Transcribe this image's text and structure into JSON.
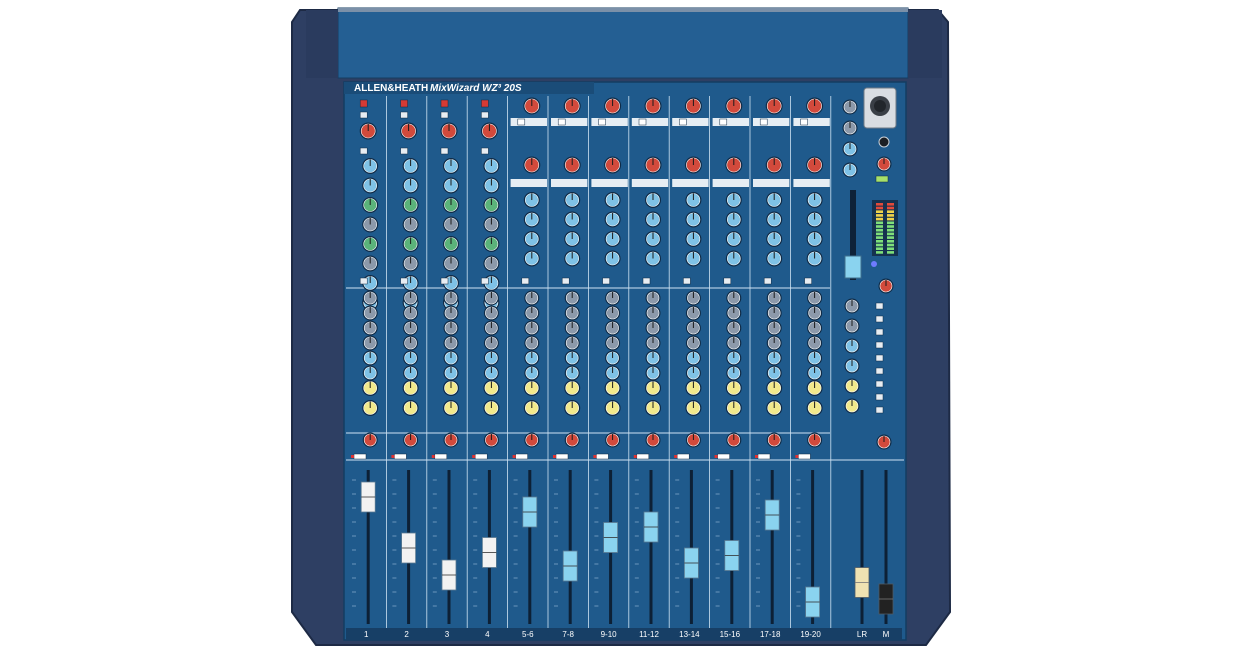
{
  "panel": {
    "brand": "ALLEN&HEATH",
    "model": "MixWizard WZ³ 20S"
  },
  "strips": [
    {
      "label": "1",
      "type": "mono",
      "fader_level": 0.82
    },
    {
      "label": "2",
      "type": "mono",
      "fader_level": 0.48
    },
    {
      "label": "3",
      "type": "mono",
      "fader_level": 0.3
    },
    {
      "label": "4",
      "type": "mono",
      "fader_level": 0.45
    },
    {
      "label": "5-6",
      "type": "stereo",
      "fader_level": 0.72
    },
    {
      "label": "7-8",
      "type": "stereo",
      "fader_level": 0.36
    },
    {
      "label": "9-10",
      "type": "stereo",
      "fader_level": 0.55
    },
    {
      "label": "11-12",
      "type": "stereo",
      "fader_level": 0.62
    },
    {
      "label": "13-14",
      "type": "stereo",
      "fader_level": 0.38
    },
    {
      "label": "15-16",
      "type": "stereo",
      "fader_level": 0.43
    },
    {
      "label": "17-18",
      "type": "stereo",
      "fader_level": 0.7
    },
    {
      "label": "19-20",
      "type": "stereo",
      "fader_level": 0.12
    }
  ],
  "masters": [
    {
      "label": "LR",
      "fader_level": 0.25
    },
    {
      "label": "M",
      "fader_level": 0.14
    }
  ],
  "colors": {
    "panel": "#1f5a8c",
    "panel_dark": "#173f66",
    "frame": "#2e3f63",
    "knob_blue": "#7fc2e6",
    "knob_green": "#5bb37a",
    "knob_red": "#d24a3c",
    "knob_yellow": "#f2e98c",
    "knob_grey": "#8c99aa",
    "fader_white": "#f2f2f2",
    "fader_blue": "#8ad3ef",
    "fader_cream": "#efe2b2",
    "fader_black": "#222222"
  }
}
